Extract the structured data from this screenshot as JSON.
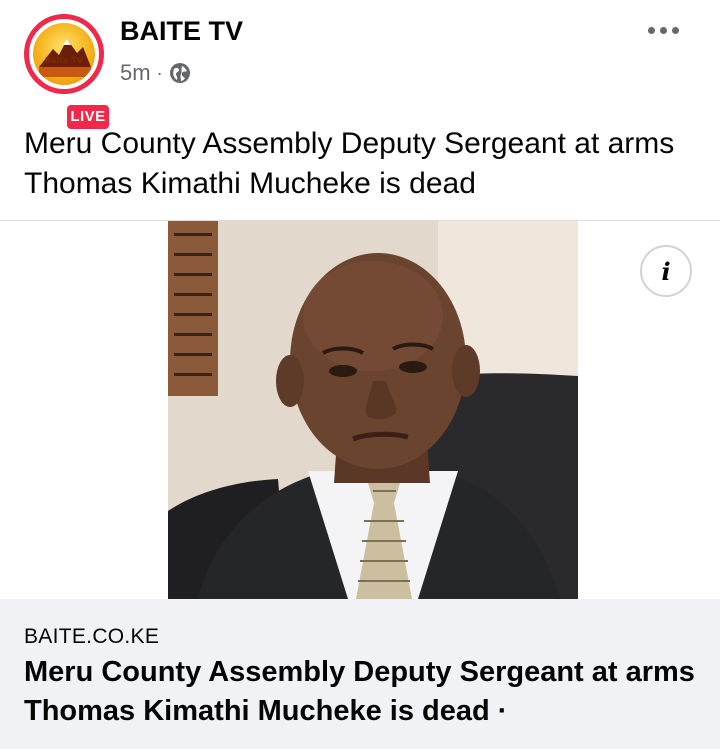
{
  "post": {
    "page_name": "BAITE TV",
    "avatar_text": "Baite TV",
    "live_badge": "LIVE",
    "time": "5m",
    "separator": "·",
    "privacy_icon": "globe-icon",
    "more_icon": "more-options-icon",
    "text": "Meru County Assembly Deputy Sergeant at arms Thomas Kimathi Mucheke is dead"
  },
  "media": {
    "info_label": "i",
    "info_icon": "info-icon"
  },
  "link_preview": {
    "domain": "BAITE.CO.KE",
    "title": "Meru County Assembly Deputy Sergeant at arms Thomas Kimathi Mucheke is dead ·"
  },
  "colors": {
    "live_red": "#f02849",
    "secondary_text": "#65676b",
    "link_bg": "#f0f2f5"
  }
}
